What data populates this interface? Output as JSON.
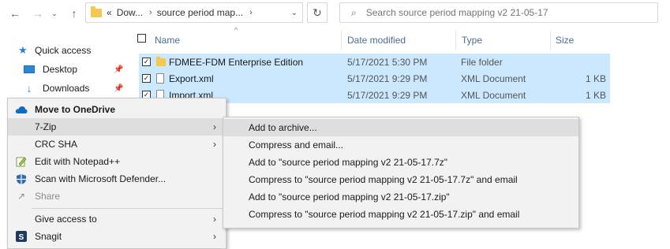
{
  "toolbar": {
    "back_icon": "arrow-left-icon",
    "forward_icon": "arrow-right-icon",
    "recent_icon": "chevron-down-icon",
    "up_icon": "arrow-up-icon",
    "refresh_icon": "refresh-icon"
  },
  "address": {
    "overflow": "«",
    "crumbs": [
      "Dow...",
      "source period map..."
    ]
  },
  "search": {
    "placeholder": "Search source period mapping v2 21-05-17"
  },
  "columns": {
    "name": "Name",
    "date": "Date modified",
    "type": "Type",
    "size": "Size"
  },
  "nav": {
    "items": [
      {
        "label": "Quick access",
        "icon": "star-icon"
      },
      {
        "label": "Desktop",
        "icon": "desktop-icon",
        "pinned": true
      },
      {
        "label": "Downloads",
        "icon": "download-icon",
        "pinned": true
      }
    ]
  },
  "files": [
    {
      "name": "FDMEE-FDM Enterprise Edition",
      "date": "5/17/2021 5:30 PM",
      "type": "File folder",
      "size": "",
      "icon": "folder-icon",
      "checked": true
    },
    {
      "name": "Export.xml",
      "date": "5/17/2021 9:29 PM",
      "type": "XML Document",
      "size": "1 KB",
      "icon": "document-icon",
      "checked": true
    },
    {
      "name": "Import.xml",
      "date": "5/17/2021 9:29 PM",
      "type": "XML Document",
      "size": "1 KB",
      "icon": "document-icon",
      "checked": true
    }
  ],
  "context_menu": {
    "items": [
      {
        "label": "Move to OneDrive",
        "icon": "onedrive-icon",
        "bold": true
      },
      {
        "label": "7-Zip",
        "submenu": true,
        "highlighted": true
      },
      {
        "label": "CRC SHA",
        "submenu": true
      },
      {
        "label": "Edit with Notepad++",
        "icon": "notepadpp-icon"
      },
      {
        "label": "Scan with Microsoft Defender...",
        "icon": "defender-icon"
      },
      {
        "label": "Share",
        "icon": "share-icon",
        "disabled": true
      },
      {
        "label": "Give access to",
        "submenu": true
      },
      {
        "label": "Snagit",
        "icon": "snagit-icon",
        "submenu": true
      }
    ]
  },
  "submenu_7zip": {
    "items": [
      {
        "label": "Add to archive...",
        "highlighted": true
      },
      {
        "label": "Compress and email..."
      },
      {
        "label": "Add to \"source period mapping v2 21-05-17.7z\""
      },
      {
        "label": "Compress to \"source period mapping v2 21-05-17.7z\" and email"
      },
      {
        "label": "Add to \"source period mapping v2 21-05-17.zip\""
      },
      {
        "label": "Compress to \"source period mapping v2 21-05-17.zip\" and email"
      }
    ]
  },
  "colors": {
    "selection": "#cce8ff",
    "header_text": "#4a6d95",
    "menu_bg": "#f2f2f2",
    "menu_hover": "#dedede",
    "folder": "#f5c74a",
    "onedrive": "#0f6cbd"
  }
}
